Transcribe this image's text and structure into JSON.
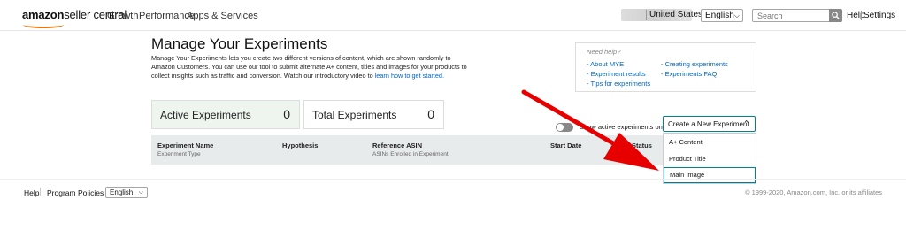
{
  "header": {
    "logo_bold": "amazon",
    "logo_light": "seller central",
    "nav": [
      "Growth",
      "Performance",
      "Apps & Services"
    ],
    "country": "United States",
    "language": "English",
    "search_placeholder": "Search",
    "help": "Help",
    "settings": "Settings"
  },
  "page": {
    "title": "Manage Your Experiments",
    "description": "Manage Your Experiments lets you create two different versions of content, which are shown randomly to Amazon Customers. You can use our tool to submit alternate A+ content, titles and images for your products to collect insights such as traffic and conversion. Watch our introductory video to",
    "description_link": "learn how to get started."
  },
  "help_box": {
    "title": "Need help?",
    "left_links": [
      "- About MYE",
      "- Experiment results",
      "- Tips for experiments"
    ],
    "right_links": [
      "- Creating experiments",
      "- Experiments FAQ"
    ]
  },
  "stats": {
    "active_label": "Active Experiments",
    "active_count": "0",
    "total_label": "Total Experiments",
    "total_count": "0"
  },
  "toggle": {
    "label": "Show active experiments only"
  },
  "create_button": {
    "label": "Create a New Experiment"
  },
  "dropdown": {
    "items": [
      "A+ Content",
      "Product Title",
      "Main Image"
    ],
    "highlighted": "Main Image"
  },
  "table": {
    "columns": [
      {
        "header": "Experiment Name",
        "sub": "Experiment Type"
      },
      {
        "header": "Hypothesis",
        "sub": ""
      },
      {
        "header": "Reference ASIN",
        "sub": "ASINs Enrolled in Experiment"
      },
      {
        "header": "Start Date",
        "sub": ""
      },
      {
        "header": "Status",
        "sub": ""
      }
    ]
  },
  "footer": {
    "help": "Help",
    "program_policies": "Program Policies",
    "language": "English",
    "copyright": "© 1999-2020, Amazon.com, Inc. or its affiliates"
  },
  "colors": {
    "accent": "#008296",
    "link": "#0066c0",
    "stat_card_active": "#eef5ee",
    "annotation_arrow": "#e60000"
  }
}
